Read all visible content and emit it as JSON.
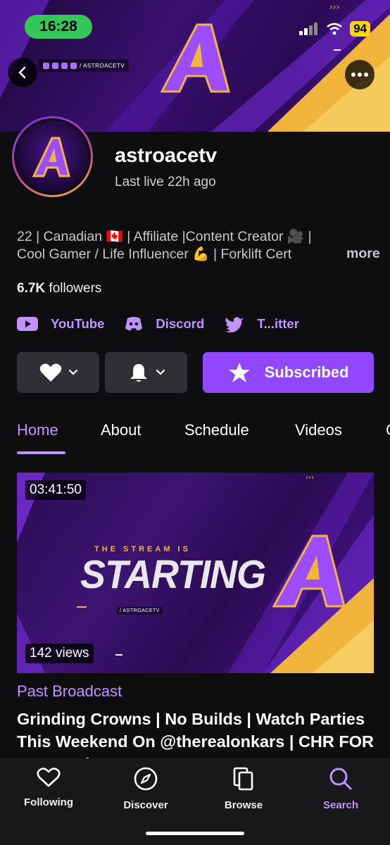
{
  "status_bar": {
    "time": "16:28",
    "battery": "94"
  },
  "banner": {
    "social_handle": "/ ASTROACETV"
  },
  "profile": {
    "channel_name": "astroacetv",
    "last_live": "Last live 22h ago",
    "bio_line1": "22 | Canadian 🇨🇦 | Affiliate |Content Creator 🎥 |",
    "bio_line2": "Cool Gamer / Life Influencer 💪 | Forklift Cert",
    "bio_more": "more",
    "followers_count": "6.7K",
    "followers_label": "followers"
  },
  "links": [
    {
      "label": "YouTube",
      "icon": "youtube-icon"
    },
    {
      "label": "Discord",
      "icon": "discord-icon"
    },
    {
      "label": "T...itter",
      "icon": "twitter-icon"
    }
  ],
  "actions": {
    "subscribe_label": "Subscribed"
  },
  "tabs": [
    {
      "label": "Home",
      "active": true
    },
    {
      "label": "About"
    },
    {
      "label": "Schedule"
    },
    {
      "label": "Videos"
    }
  ],
  "video": {
    "duration": "03:41:50",
    "views": "142 views",
    "thumb_subtitle": "THE STREAM IS",
    "thumb_title": "STARTING",
    "thumb_handle": "/ ASTROACETV",
    "category": "Past Broadcast",
    "title": "Grinding Crowns | No Builds | Watch Parties This Weekend On @therealonkars | CHR FOR NO ADS | "
  },
  "bottom_nav": [
    {
      "label": "Following",
      "icon": "heart-icon"
    },
    {
      "label": "Discover",
      "icon": "compass-icon"
    },
    {
      "label": "Browse",
      "icon": "browse-icon"
    },
    {
      "label": "Search",
      "icon": "search-icon",
      "active": true
    }
  ],
  "colors": {
    "accent": "#bf94ff",
    "brand": "#9147ff",
    "background": "#0e0e10"
  }
}
